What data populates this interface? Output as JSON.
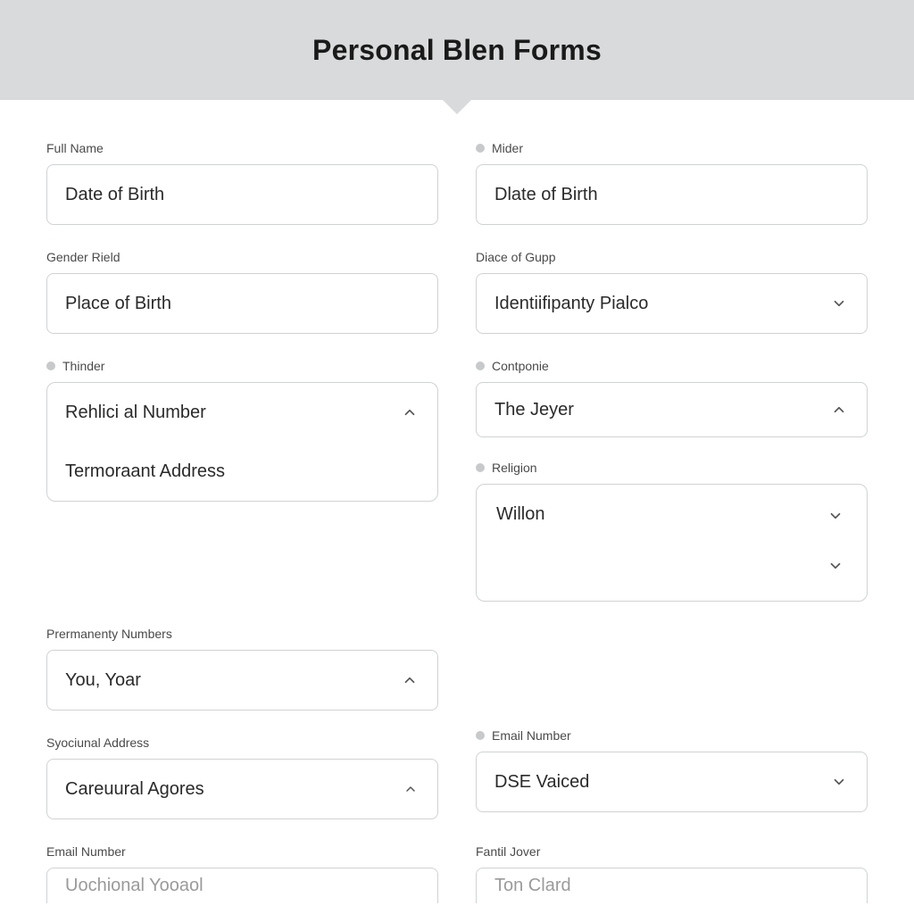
{
  "header": {
    "title": "Personal Blen Forms"
  },
  "left": {
    "full_name": {
      "label": "Full Name",
      "value": "Date of Birth"
    },
    "gender_field": {
      "label": "Gender Rield",
      "value": "Place of Birth"
    },
    "thinder": {
      "label": "Thinder",
      "line1": "Rehlici al Number",
      "line2": "Termoraant Address"
    },
    "prermanenty": {
      "label": "Prermanenty Numbers",
      "value": "You, Yoar"
    },
    "syociunal": {
      "label": "Syociunal Address",
      "value": "Careuural Agores"
    },
    "email_number_l": {
      "label": "Email Number",
      "value": "Uochional Yooaol"
    }
  },
  "right": {
    "mider": {
      "label": "Mider",
      "value": "Dlate of Birth"
    },
    "diace_gupp": {
      "label": "Diace of Gupp",
      "value": "Identiifipanty Pialco"
    },
    "contponie": {
      "label": "Contponie",
      "value": "The Jeyer"
    },
    "religion": {
      "label": "Religion",
      "value": "Willon"
    },
    "email_number_r": {
      "label": "Email Number",
      "value": "DSE Vaiced"
    },
    "fantil_jover": {
      "label": "Fantil Jover",
      "value": "Ton Clard"
    }
  }
}
